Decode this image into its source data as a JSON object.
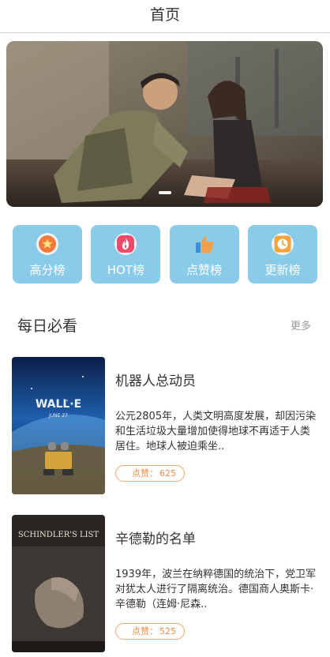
{
  "header": {
    "title": "首页"
  },
  "banner": {
    "slide_count": 1,
    "active_index": 0
  },
  "quick_nav": [
    {
      "label": "高分榜",
      "icon": "star-icon"
    },
    {
      "label": "HOT榜",
      "icon": "flame-icon"
    },
    {
      "label": "点赞榜",
      "icon": "thumbs-up-icon"
    },
    {
      "label": "更新榜",
      "icon": "clock-icon"
    }
  ],
  "section": {
    "title": "每日必看",
    "more": "更多"
  },
  "movies": [
    {
      "title": "机器人总动员",
      "description": "公元2805年，人类文明高度发展，却因污染和生活垃圾大量增加使得地球不再适于人类居住。地球人被迫乘坐..",
      "likes_label": "点赞：",
      "likes": "625",
      "poster_text": "WALL·E",
      "poster_subtext": "JUNE 27"
    },
    {
      "title": "辛德勒的名单",
      "description": "1939年，波兰在纳粹德国的统治下，党卫军对犹太人进行了隔离统治。德国商人奥斯卡·辛德勒（连姆·尼森..",
      "likes_label": "点赞：",
      "likes": "525",
      "poster_text": "SCHINDLER'S LIST"
    }
  ],
  "colors": {
    "accent": "#8bcbea",
    "likes_border": "#f3a56b",
    "likes_text": "#ef8a43"
  }
}
